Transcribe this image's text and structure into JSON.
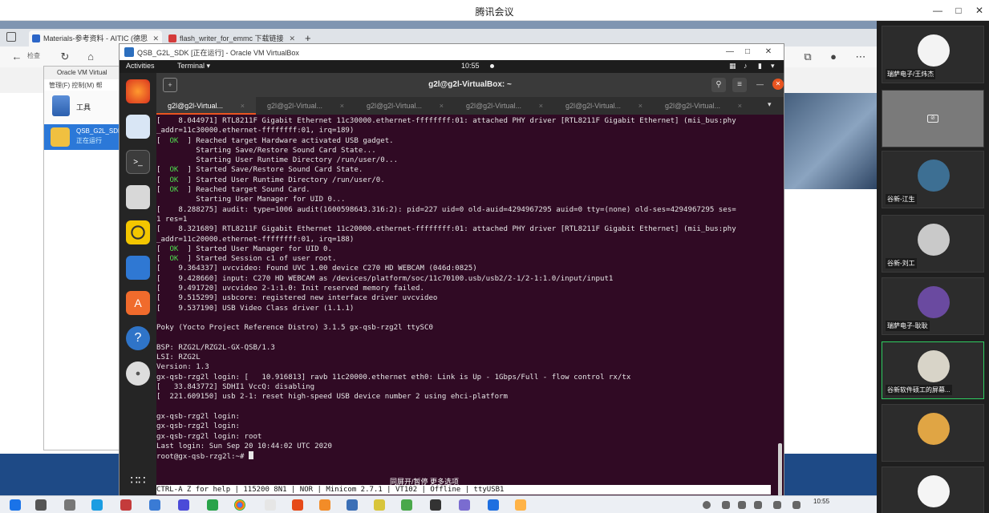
{
  "meeting": {
    "title": "腾讯会议"
  },
  "browser": {
    "tabs": [
      {
        "label": "Materials-参考资料 - AITIC (德思",
        "active": true
      },
      {
        "label": "flash_writer_for_emmc 下载链接",
        "active": false
      }
    ],
    "new_tab": "+",
    "back_hint": "检查"
  },
  "vbox_manager": {
    "title": "Oracle VM Virtual",
    "menu": "管理(F)  控制(M)  帮",
    "tools_label": "工具",
    "vm_name": "QSB_G2L_SDK",
    "vm_status": "正在运行"
  },
  "vm_window": {
    "title": "QSB_G2L_SDK [正在运行] - Oracle VM VirtualBox"
  },
  "gnome": {
    "activities": "Activities",
    "app_menu": "Terminal ▾",
    "clock": "10:55"
  },
  "terminal": {
    "title": "g2l@g2l-VirtualBox: ~",
    "tabs": [
      "g2l@g2l-Virtual...",
      "g2l@g2l-Virtual...",
      "g2l@g2l-Virtual...",
      "g2l@g2l-Virtual...",
      "g2l@g2l-Virtual...",
      "g2l@g2l-Virtual..."
    ],
    "lines": [
      {
        "pre": "[    8.044971] RTL8211F Gigabit Ethernet 11c30000.ethernet-ffffffff:01: attached PHY driver [RTL8211F Gigabit Ethernet] (mii_bus:phy",
        "ok": "",
        "post": ""
      },
      {
        "pre": "_addr=11c30000.ethernet-ffffffff:01, irq=189)",
        "ok": "",
        "post": ""
      },
      {
        "pre": "[  ",
        "ok": "OK",
        "post": "  ] Reached target Hardware activated USB gadget."
      },
      {
        "pre": "         Starting Save/Restore Sound Card State...",
        "ok": "",
        "post": ""
      },
      {
        "pre": "         Starting User Runtime Directory /run/user/0...",
        "ok": "",
        "post": ""
      },
      {
        "pre": "[  ",
        "ok": "OK",
        "post": "  ] Started Save/Restore Sound Card State."
      },
      {
        "pre": "[  ",
        "ok": "OK",
        "post": "  ] Started User Runtime Directory /run/user/0."
      },
      {
        "pre": "[  ",
        "ok": "OK",
        "post": "  ] Reached target Sound Card."
      },
      {
        "pre": "         Starting User Manager for UID 0...",
        "ok": "",
        "post": ""
      },
      {
        "pre": "[    8.288275] audit: type=1006 audit(1600598643.316:2): pid=227 uid=0 old-auid=4294967295 auid=0 tty=(none) old-ses=4294967295 ses=",
        "ok": "",
        "post": ""
      },
      {
        "pre": "1 res=1",
        "ok": "",
        "post": ""
      },
      {
        "pre": "[    8.321689] RTL8211F Gigabit Ethernet 11c20000.ethernet-ffffffff:01: attached PHY driver [RTL8211F Gigabit Ethernet] (mii_bus:phy",
        "ok": "",
        "post": ""
      },
      {
        "pre": "_addr=11c20000.ethernet-ffffffff:01, irq=188)",
        "ok": "",
        "post": ""
      },
      {
        "pre": "[  ",
        "ok": "OK",
        "post": "  ] Started User Manager for UID 0."
      },
      {
        "pre": "[  ",
        "ok": "OK",
        "post": "  ] Started Session c1 of user root."
      },
      {
        "pre": "[    9.364337] uvcvideo: Found UVC 1.00 device C270 HD WEBCAM (046d:0825)",
        "ok": "",
        "post": ""
      },
      {
        "pre": "[    9.428660] input: C270 HD WEBCAM as /devices/platform/soc/11c70100.usb/usb2/2-1/2-1:1.0/input/input1",
        "ok": "",
        "post": ""
      },
      {
        "pre": "[    9.491720] uvcvideo 2-1:1.0: Init reserved memory failed.",
        "ok": "",
        "post": ""
      },
      {
        "pre": "[    9.515299] usbcore: registered new interface driver uvcvideo",
        "ok": "",
        "post": ""
      },
      {
        "pre": "[    9.537190] USB Video Class driver (1.1.1)",
        "ok": "",
        "post": ""
      },
      {
        "pre": "",
        "ok": "",
        "post": ""
      },
      {
        "pre": "Poky (Yocto Project Reference Distro) 3.1.5 gx-qsb-rzg2l ttySC0",
        "ok": "",
        "post": ""
      },
      {
        "pre": "",
        "ok": "",
        "post": ""
      },
      {
        "pre": "BSP: RZG2L/RZG2L-GX-QSB/1.3",
        "ok": "",
        "post": ""
      },
      {
        "pre": "LSI: RZG2L",
        "ok": "",
        "post": ""
      },
      {
        "pre": "Version: 1.3",
        "ok": "",
        "post": ""
      },
      {
        "pre": "gx-qsb-rzg2l login: [   10.916813] ravb 11c20000.ethernet eth0: Link is Up - 1Gbps/Full - flow control rx/tx",
        "ok": "",
        "post": ""
      },
      {
        "pre": "[   33.843772] SDHI1 VccQ: disabling",
        "ok": "",
        "post": ""
      },
      {
        "pre": "[  221.609150] usb 2-1: reset high-speed USB device number 2 using ehci-platform",
        "ok": "",
        "post": ""
      },
      {
        "pre": "",
        "ok": "",
        "post": ""
      },
      {
        "pre": "gx-qsb-rzg2l login:",
        "ok": "",
        "post": ""
      },
      {
        "pre": "gx-qsb-rzg2l login:",
        "ok": "",
        "post": ""
      },
      {
        "pre": "gx-qsb-rzg2l login: root",
        "ok": "",
        "post": ""
      },
      {
        "pre": "Last login: Sun Sep 20 10:44:02 UTC 2020",
        "ok": "",
        "post": ""
      },
      {
        "pre": "root@gx-qsb-rzg2l:~# ",
        "ok": "",
        "post": ""
      }
    ],
    "status_line": "CTRL-A Z for help | 115200 8N1 | NOR | Minicom 2.7.1 | VT102 | Offline | ttyUSB1"
  },
  "share_caption": "同屏开/暂停  更多选项",
  "taskbar": {
    "time": "10:55"
  },
  "participants": [
    {
      "name": "瑞萨电子/王炜杰",
      "cam": true,
      "avatar_color": "#f3f3f3",
      "speaking": false
    },
    {
      "name": "",
      "cam": false,
      "avatar_color": "#7a7a7a",
      "speaking": false
    },
    {
      "name": "谷新-江生",
      "cam": true,
      "avatar_color": "#3d6f93",
      "speaking": false
    },
    {
      "name": "谷新-刘工",
      "cam": true,
      "avatar_color": "#c9c9c9",
      "speaking": false
    },
    {
      "name": "瑞萨电子-耿耿",
      "cam": true,
      "avatar_color": "#6a4aa0",
      "speaking": false
    },
    {
      "name": "谷新软件硕工的屏幕...",
      "cam": true,
      "avatar_color": "#d8d4c8",
      "speaking": true
    },
    {
      "name": "",
      "cam": true,
      "avatar_color": "#e0a544",
      "speaking": false
    },
    {
      "name": "",
      "cam": true,
      "avatar_color": "#f5f5f5",
      "speaking": false
    }
  ],
  "colors": {
    "terminal_bg": "#300a24",
    "ubuntu_orange": "#e95420",
    "ok_green": "#4fdc4f",
    "speaking_border": "#2fcd61"
  }
}
